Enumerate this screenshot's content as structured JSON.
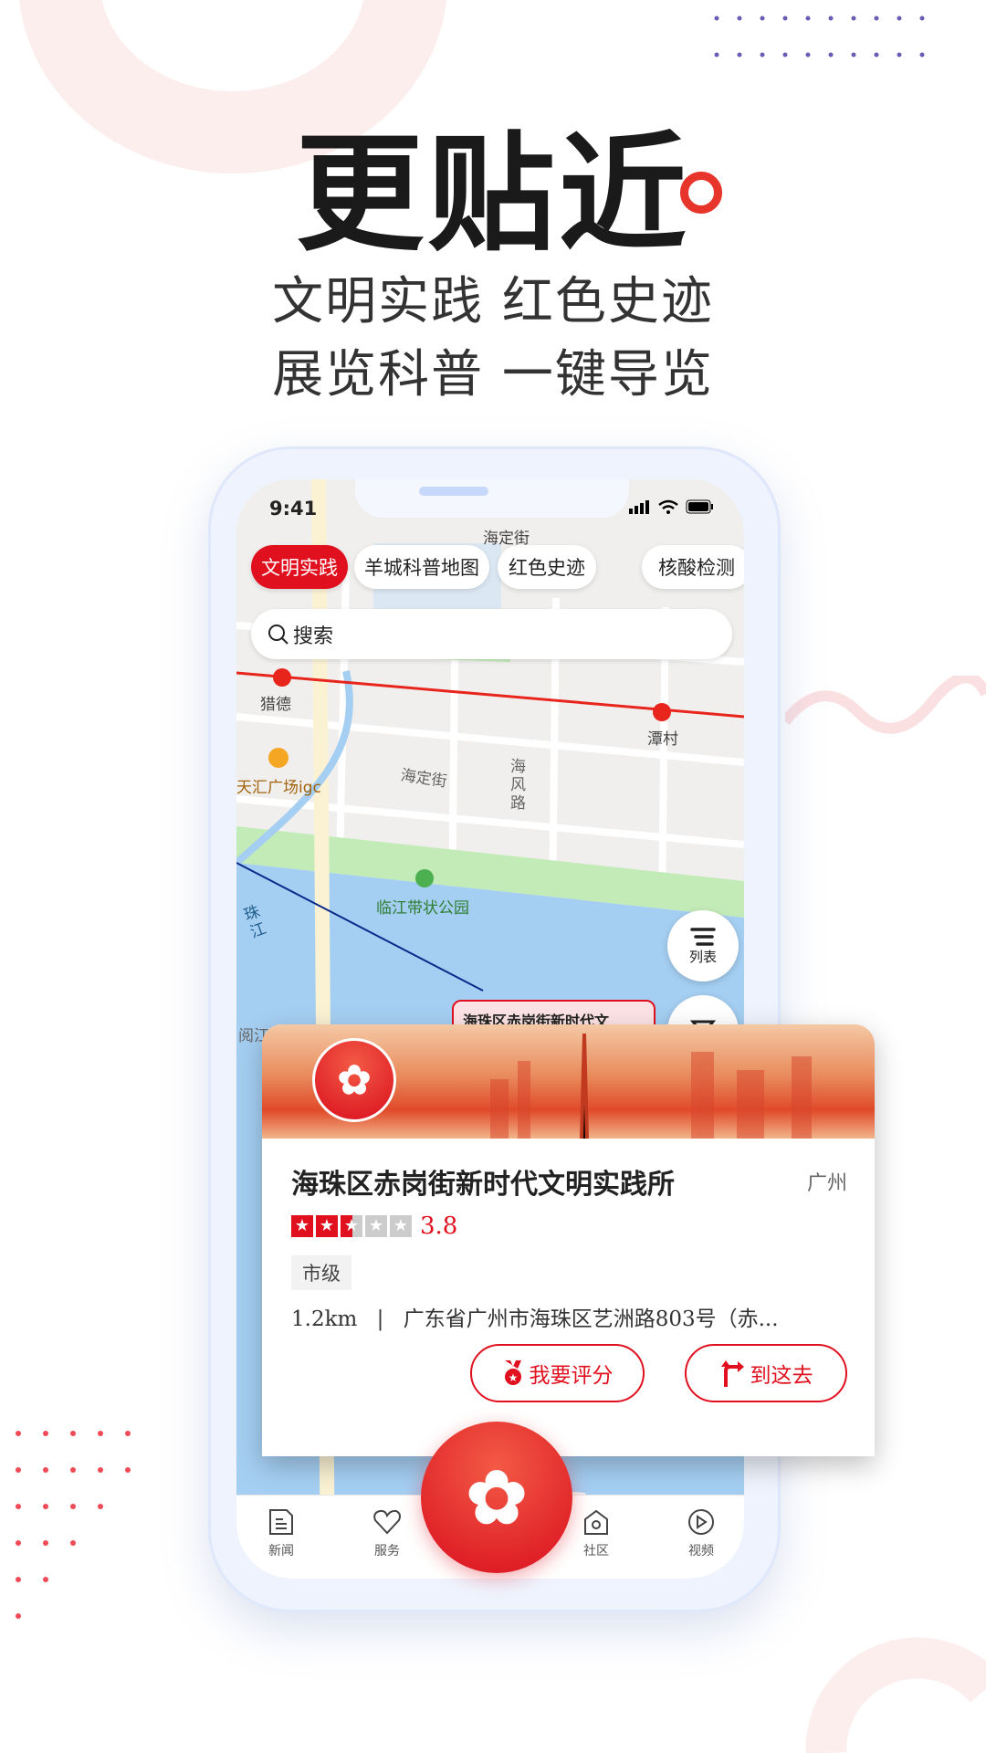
{
  "hero": {
    "headline": "更贴近",
    "line1": "文明实践 红色史迹",
    "line2": "展览科普 一键导览"
  },
  "colors": {
    "accent": "#e0101e",
    "water": "#a5cff2",
    "park": "#c3ebb8"
  },
  "status": {
    "time": "9:41"
  },
  "chips": [
    {
      "label": "文明实践",
      "active": true
    },
    {
      "label": "羊城科普地图"
    },
    {
      "label": "红色史迹"
    },
    {
      "label": "核酸检测"
    }
  ],
  "search": {
    "placeholder": "搜索"
  },
  "map": {
    "labels": {
      "street_top": "海定街",
      "metro1": "猎德",
      "metro2": "潭村",
      "mall": "天汇广场igc",
      "street": "海定街",
      "road": "海风路",
      "park": "临江带状公园",
      "river": "珠江",
      "bottom_left": "阅江",
      "marker": "海珠区赤岗街新时代文"
    },
    "buttons": {
      "list": "列表"
    }
  },
  "card": {
    "title": "海珠区赤岗街新时代文明实践所",
    "city": "广州",
    "rating": 3.8,
    "rating_text": "3.8",
    "stars_max": 5,
    "tag": "市级",
    "distance": "1.2km",
    "separator": "|",
    "address": "广东省广州市海珠区艺洲路803号（赤...",
    "rate_button": "我要评分",
    "go_button": "到这去"
  },
  "nav": [
    {
      "label": "新闻",
      "icon": "news-icon"
    },
    {
      "label": "服务",
      "icon": "heart-icon"
    },
    {
      "label": "社区",
      "icon": "community-icon"
    },
    {
      "label": "视频",
      "icon": "video-icon"
    }
  ]
}
